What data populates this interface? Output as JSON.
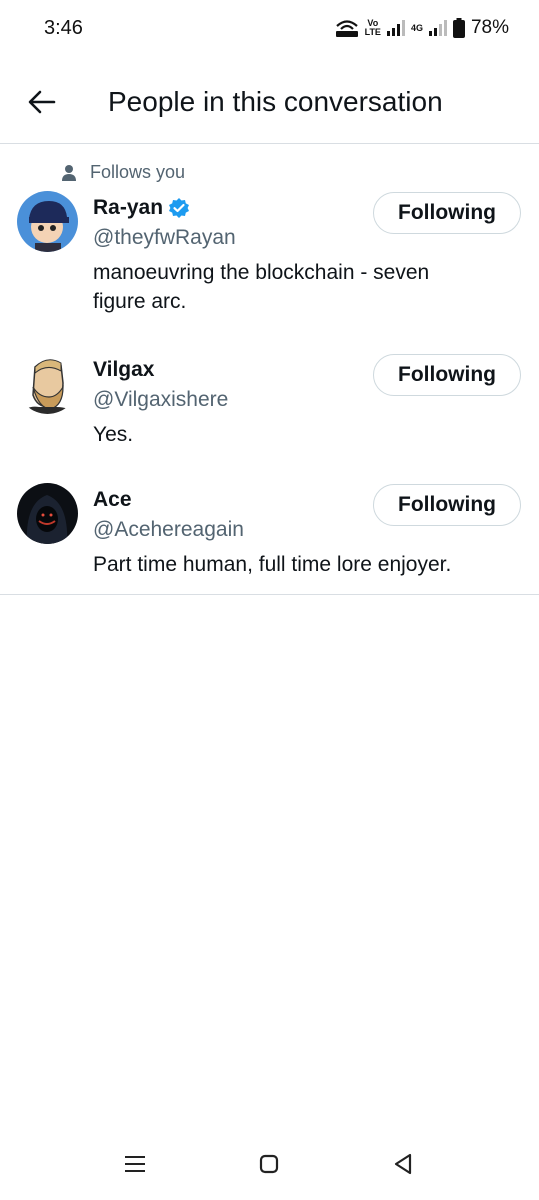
{
  "status_bar": {
    "time": "3:46",
    "battery": "78%",
    "network_label_top": "Vo",
    "network_label_bottom": "LTE",
    "network_4g": "4G"
  },
  "header": {
    "title": "People in this conversation",
    "back_icon": "arrow-left-icon"
  },
  "people": [
    {
      "context_label": "Follows you",
      "name": "Ra-yan",
      "verified": true,
      "handle": "@theyfwRayan",
      "bio_line1": "manoeuvring the blockchain - seven",
      "bio_line2": "figure arc.",
      "button": "Following"
    },
    {
      "name": "Vilgax",
      "handle": "@Vilgaxishere",
      "bio": "Yes.",
      "button": "Following"
    },
    {
      "name": "Ace",
      "handle": "@Acehereagain",
      "bio": "Part time human, full time lore enjoyer.",
      "button": "Following"
    }
  ],
  "colors": {
    "text_primary": "#0f1419",
    "text_secondary": "#536471",
    "verified_blue": "#1d9bf0",
    "divider": "#d9dee3",
    "button_border": "#cfd9de"
  },
  "nav_bar": {
    "icons": [
      "menu-icon",
      "home-square-icon",
      "back-triangle-icon"
    ]
  }
}
